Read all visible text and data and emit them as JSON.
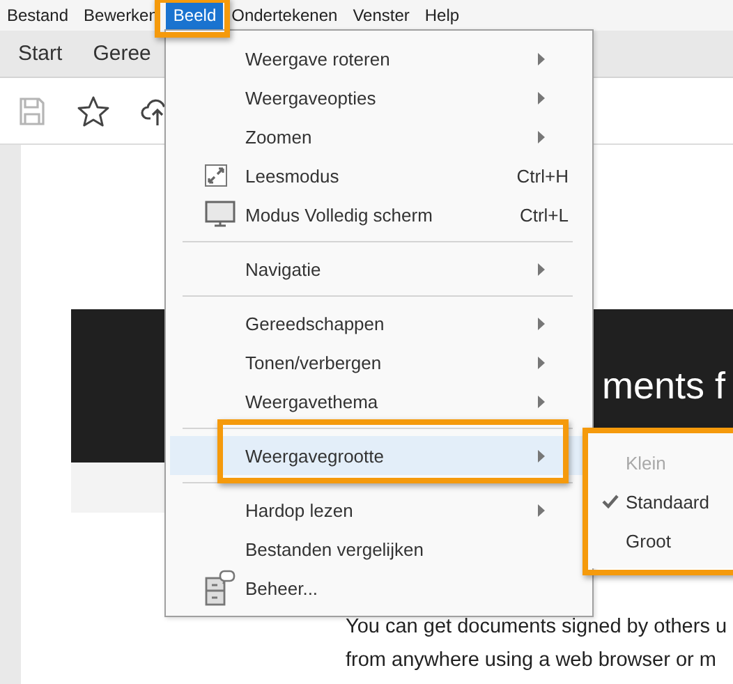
{
  "menubar": [
    {
      "label": "Bestand",
      "selected": false
    },
    {
      "label": "Bewerken",
      "selected": false
    },
    {
      "label": "Beeld",
      "selected": true
    },
    {
      "label": "Ondertekenen",
      "selected": false
    },
    {
      "label": "Venster",
      "selected": false
    },
    {
      "label": "Help",
      "selected": false
    }
  ],
  "tabs": [
    {
      "label": "Start"
    },
    {
      "label": "Geree"
    }
  ],
  "document": {
    "banner_text": "ments f",
    "paragraph_lines": [
      "You can get documents signed by others u",
      "from anywhere using a web browser or m"
    ]
  },
  "menu": [
    {
      "kind": "item",
      "label": "Weergave roteren",
      "submenu": true,
      "selected": false
    },
    {
      "kind": "item",
      "label": "Weergaveopties",
      "submenu": true,
      "selected": false
    },
    {
      "kind": "item",
      "label": "Zoomen",
      "submenu": true,
      "selected": false
    },
    {
      "kind": "item",
      "label": "Leesmodus",
      "shortcut": "Ctrl+H",
      "submenu": false,
      "selected": false
    },
    {
      "kind": "item",
      "label": "Modus Volledig scherm",
      "shortcut": "Ctrl+L",
      "submenu": false,
      "selected": false
    },
    {
      "kind": "separator"
    },
    {
      "kind": "item",
      "label": "Navigatie",
      "submenu": true,
      "selected": false
    },
    {
      "kind": "separator"
    },
    {
      "kind": "item",
      "label": "Gereedschappen",
      "submenu": true,
      "selected": false
    },
    {
      "kind": "item",
      "label": "Tonen/verbergen",
      "submenu": true,
      "selected": false
    },
    {
      "kind": "item",
      "label": "Weergavethema",
      "submenu": true,
      "selected": false
    },
    {
      "kind": "separator"
    },
    {
      "kind": "item",
      "label": "Weergavegrootte",
      "submenu": true,
      "selected": true
    },
    {
      "kind": "separator"
    },
    {
      "kind": "item",
      "label": "Hardop lezen",
      "submenu": true,
      "selected": false
    },
    {
      "kind": "item",
      "label": "Bestanden vergelijken",
      "submenu": false,
      "selected": false
    },
    {
      "kind": "item",
      "label": "Beheer...",
      "submenu": false,
      "selected": false
    }
  ],
  "submenu": [
    {
      "label": "Klein",
      "disabled": true,
      "checked": false
    },
    {
      "label": "Standaard",
      "disabled": false,
      "checked": true
    },
    {
      "label": "Groot",
      "disabled": false,
      "checked": false
    }
  ]
}
